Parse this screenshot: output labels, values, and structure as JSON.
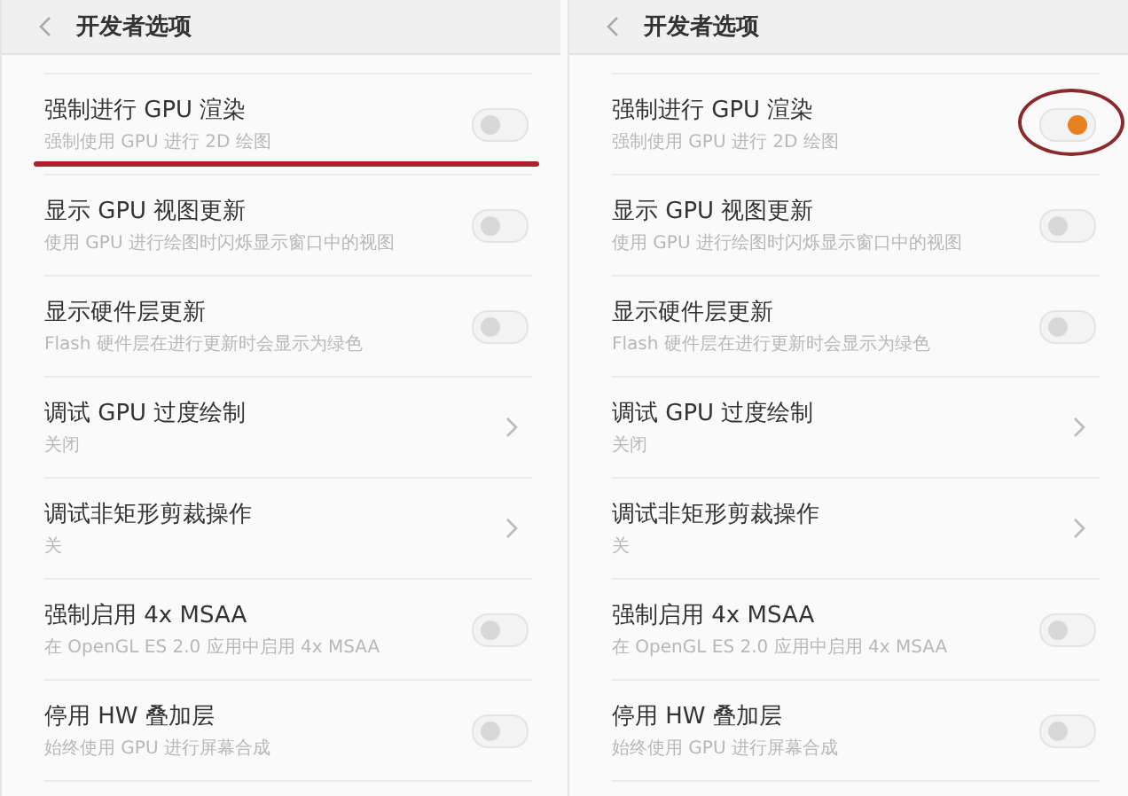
{
  "panels": [
    {
      "title": "开发者选项",
      "items": [
        {
          "kind": "toggle",
          "title": "强制进行 GPU 渲染",
          "subtitle": "强制使用 GPU 进行 2D 绘图",
          "on": false,
          "underlined": true,
          "circled": false
        },
        {
          "kind": "toggle",
          "title": "显示 GPU 视图更新",
          "subtitle": "使用 GPU 进行绘图时闪烁显示窗口中的视图",
          "on": false,
          "underlined": false,
          "circled": false
        },
        {
          "kind": "toggle",
          "title": "显示硬件层更新",
          "subtitle": "Flash 硬件层在进行更新时会显示为绿色",
          "on": false,
          "underlined": false,
          "circled": false
        },
        {
          "kind": "link",
          "title": "调试 GPU 过度绘制",
          "subtitle": "关闭",
          "underlined": false,
          "circled": false
        },
        {
          "kind": "link",
          "title": "调试非矩形剪裁操作",
          "subtitle": "关",
          "underlined": false,
          "circled": false
        },
        {
          "kind": "toggle",
          "title": "强制启用 4x MSAA",
          "subtitle": "在 OpenGL ES 2.0 应用中启用 4x MSAA",
          "on": false,
          "underlined": false,
          "circled": false
        },
        {
          "kind": "toggle",
          "title": "停用 HW 叠加层",
          "subtitle": "始终使用 GPU 进行屏幕合成",
          "on": false,
          "underlined": false,
          "circled": false
        }
      ]
    },
    {
      "title": "开发者选项",
      "items": [
        {
          "kind": "toggle",
          "title": "强制进行 GPU 渲染",
          "subtitle": "强制使用 GPU 进行 2D 绘图",
          "on": true,
          "underlined": false,
          "circled": true
        },
        {
          "kind": "toggle",
          "title": "显示 GPU 视图更新",
          "subtitle": "使用 GPU 进行绘图时闪烁显示窗口中的视图",
          "on": false,
          "underlined": false,
          "circled": false
        },
        {
          "kind": "toggle",
          "title": "显示硬件层更新",
          "subtitle": "Flash 硬件层在进行更新时会显示为绿色",
          "on": false,
          "underlined": false,
          "circled": false
        },
        {
          "kind": "link",
          "title": "调试 GPU 过度绘制",
          "subtitle": "关闭",
          "underlined": false,
          "circled": false
        },
        {
          "kind": "link",
          "title": "调试非矩形剪裁操作",
          "subtitle": "关",
          "underlined": false,
          "circled": false
        },
        {
          "kind": "toggle",
          "title": "强制启用 4x MSAA",
          "subtitle": "在 OpenGL ES 2.0 应用中启用 4x MSAA",
          "on": false,
          "underlined": false,
          "circled": false
        },
        {
          "kind": "toggle",
          "title": "停用 HW 叠加层",
          "subtitle": "始终使用 GPU 进行屏幕合成",
          "on": false,
          "underlined": false,
          "circled": false
        }
      ]
    }
  ]
}
